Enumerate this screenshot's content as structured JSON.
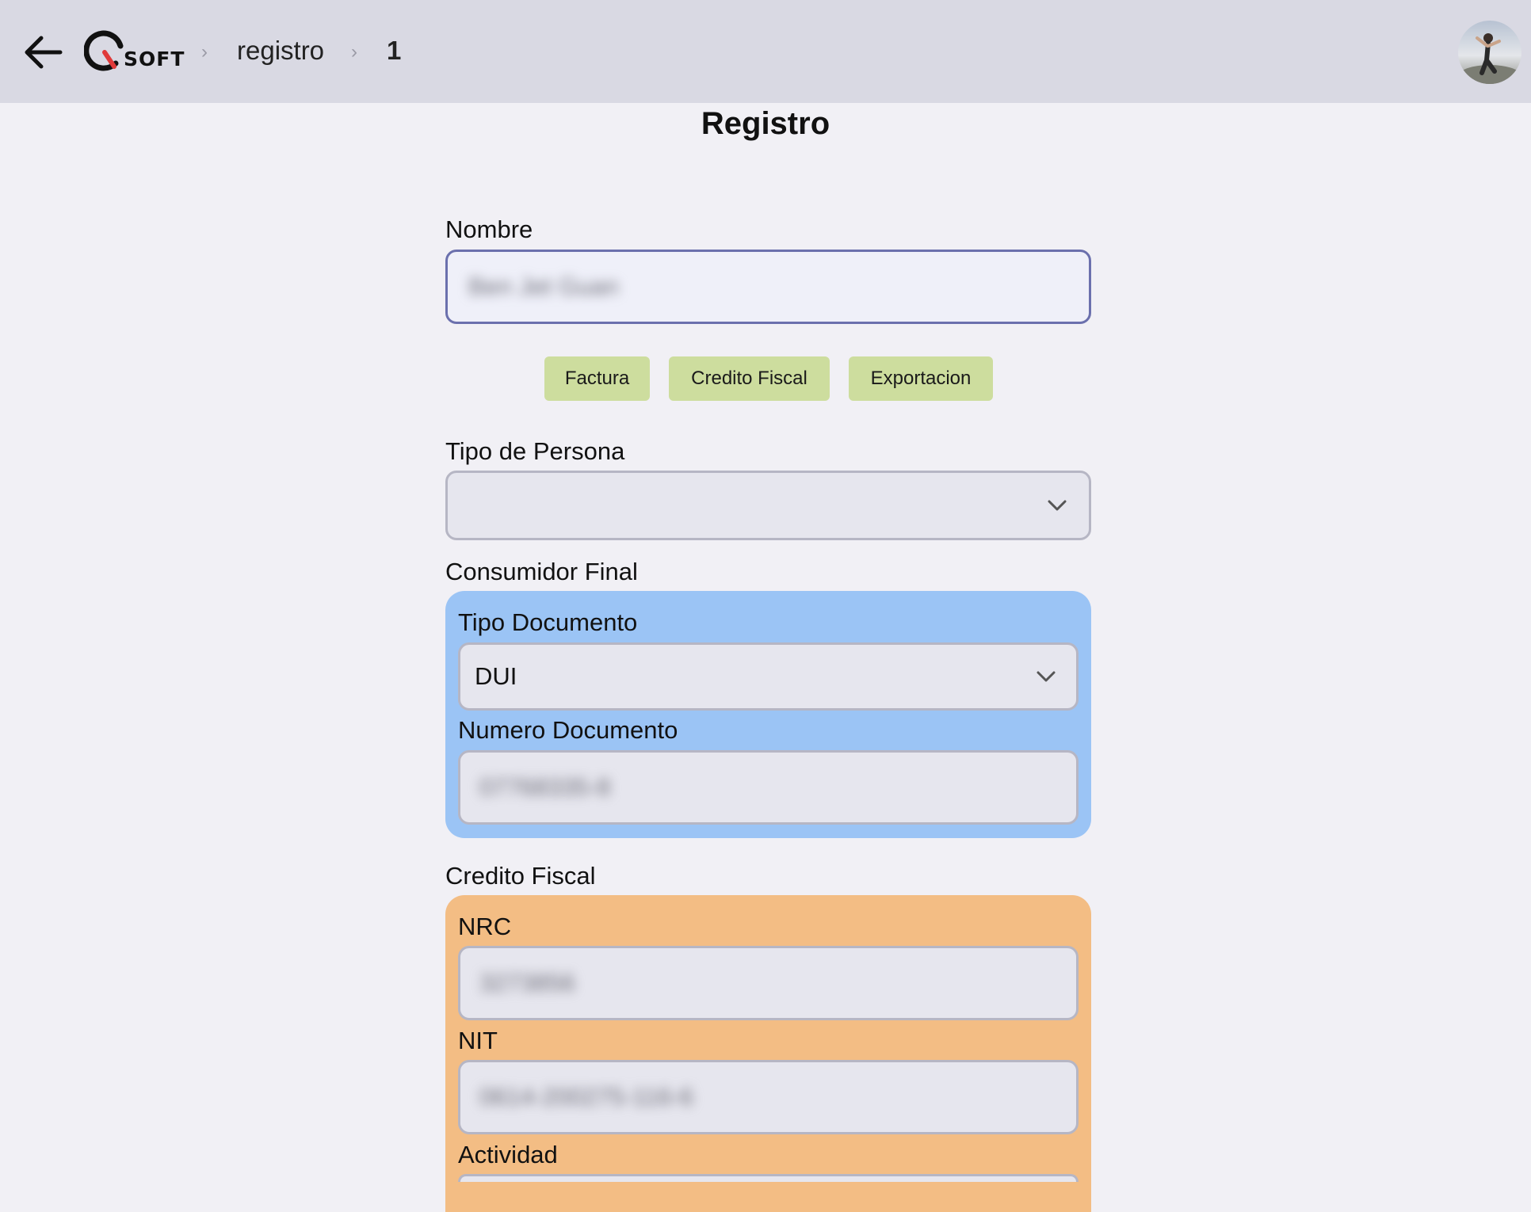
{
  "header": {
    "logo_text": "SOFT",
    "breadcrumb": [
      {
        "label": "registro"
      },
      {
        "label": "1"
      }
    ]
  },
  "page": {
    "title": "Registro"
  },
  "form": {
    "nombre": {
      "label": "Nombre",
      "value": "Ben Jet Guan"
    },
    "doc_buttons": [
      "Factura",
      "Credito Fiscal",
      "Exportacion"
    ],
    "tipo_persona": {
      "label": "Tipo de Persona",
      "value": ""
    },
    "consumidor_final": {
      "section_label": "Consumidor Final",
      "tipo_documento": {
        "label": "Tipo Documento",
        "value": "DUI"
      },
      "numero_documento": {
        "label": "Numero Documento",
        "value": "07768335-8"
      }
    },
    "credito_fiscal": {
      "section_label": "Credito Fiscal",
      "nrc": {
        "label": "NRC",
        "value": "3273856"
      },
      "nit": {
        "label": "NIT",
        "value": "0614-200275-116-6"
      },
      "actividad": {
        "label": "Actividad"
      }
    }
  },
  "colors": {
    "header_bg": "#d9d9e3",
    "page_bg": "#f1f0f5",
    "doc_button_bg": "#cddd9e",
    "consumidor_panel": "#9bc4f5",
    "credito_panel": "#f3bd84",
    "active_border": "#6b70ad"
  },
  "icons": {
    "back": "arrow-left-icon",
    "logo": "qsoft-logo",
    "breadcrumb_separator": "chevron-right-icon",
    "select_arrow": "chevron-down-icon",
    "avatar": "user-avatar"
  }
}
